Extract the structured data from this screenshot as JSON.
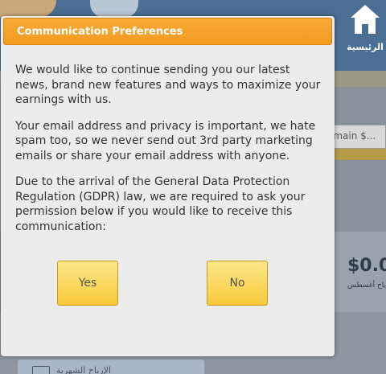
{
  "background": {
    "home_label": "الرئيسية",
    "domain_input_text": "omain $...",
    "amount": "$0.0",
    "amount_label": "أرباح أغسطس",
    "bottom_tab_label": "الإرباح الشهرية"
  },
  "dialog": {
    "title": "Communication Preferences",
    "paragraphs": [
      "We would like to continue sending you our latest news, brand new features and ways to maximize your earnings with us.",
      "Your email address and privacy is important, we hate spam too, so we never send out 3rd party marketing emails or share your email address with anyone.",
      "Due to the arrival of the General Data Protection Regulation (GDPR) law, we are required to ask your permission below if you would like to receive this communication:"
    ],
    "yes_label": "Yes",
    "no_label": "No"
  },
  "colors": {
    "header_orange": "#f5a12a",
    "button_yellow": "#fbd85a",
    "dialog_bg": "#ececec",
    "app_header_blue": "#4a6f93"
  }
}
